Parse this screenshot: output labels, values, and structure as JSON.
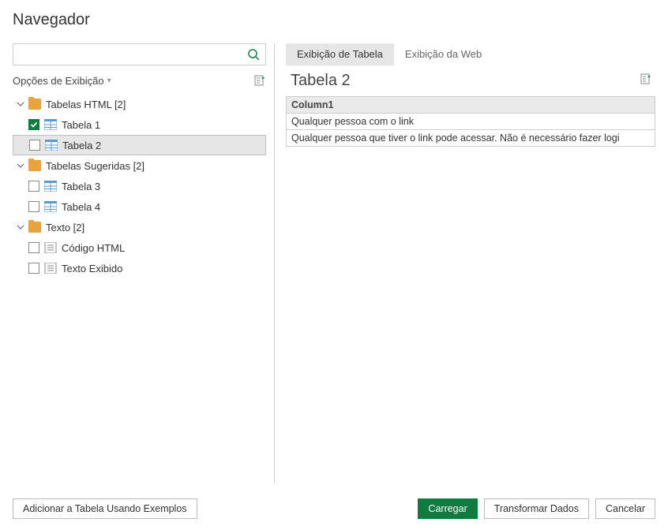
{
  "title": "Navegador",
  "search": {
    "placeholder": ""
  },
  "display_options": {
    "label": "Opções de Exibição"
  },
  "tree": {
    "groups": [
      {
        "label": "Tabelas HTML [2]",
        "type": "folder",
        "items": [
          {
            "label": "Tabela 1",
            "icon": "table",
            "checked": true,
            "selected": false
          },
          {
            "label": "Tabela 2",
            "icon": "table",
            "checked": false,
            "selected": true
          }
        ]
      },
      {
        "label": "Tabelas Sugeridas [2]",
        "type": "folder",
        "items": [
          {
            "label": "Tabela 3",
            "icon": "table",
            "checked": false,
            "selected": false
          },
          {
            "label": "Tabela 4",
            "icon": "table",
            "checked": false,
            "selected": false
          }
        ]
      },
      {
        "label": "Texto [2]",
        "type": "folder",
        "items": [
          {
            "label": "Código HTML",
            "icon": "text",
            "checked": false,
            "selected": false
          },
          {
            "label": "Texto Exibido",
            "icon": "text",
            "checked": false,
            "selected": false
          }
        ]
      }
    ]
  },
  "tabs": {
    "active": 0,
    "items": [
      "Exibição de Tabela",
      "Exibição da Web"
    ]
  },
  "preview": {
    "title": "Tabela 2",
    "columns": [
      "Column1"
    ],
    "rows": [
      [
        "Qualquer pessoa com o link"
      ],
      [
        "Qualquer pessoa que tiver o link pode acessar. Não é necessário fazer logi"
      ]
    ]
  },
  "footer": {
    "add_table": "Adicionar a Tabela Usando Exemplos",
    "load": "Carregar",
    "transform": "Transformar Dados",
    "cancel": "Cancelar"
  }
}
